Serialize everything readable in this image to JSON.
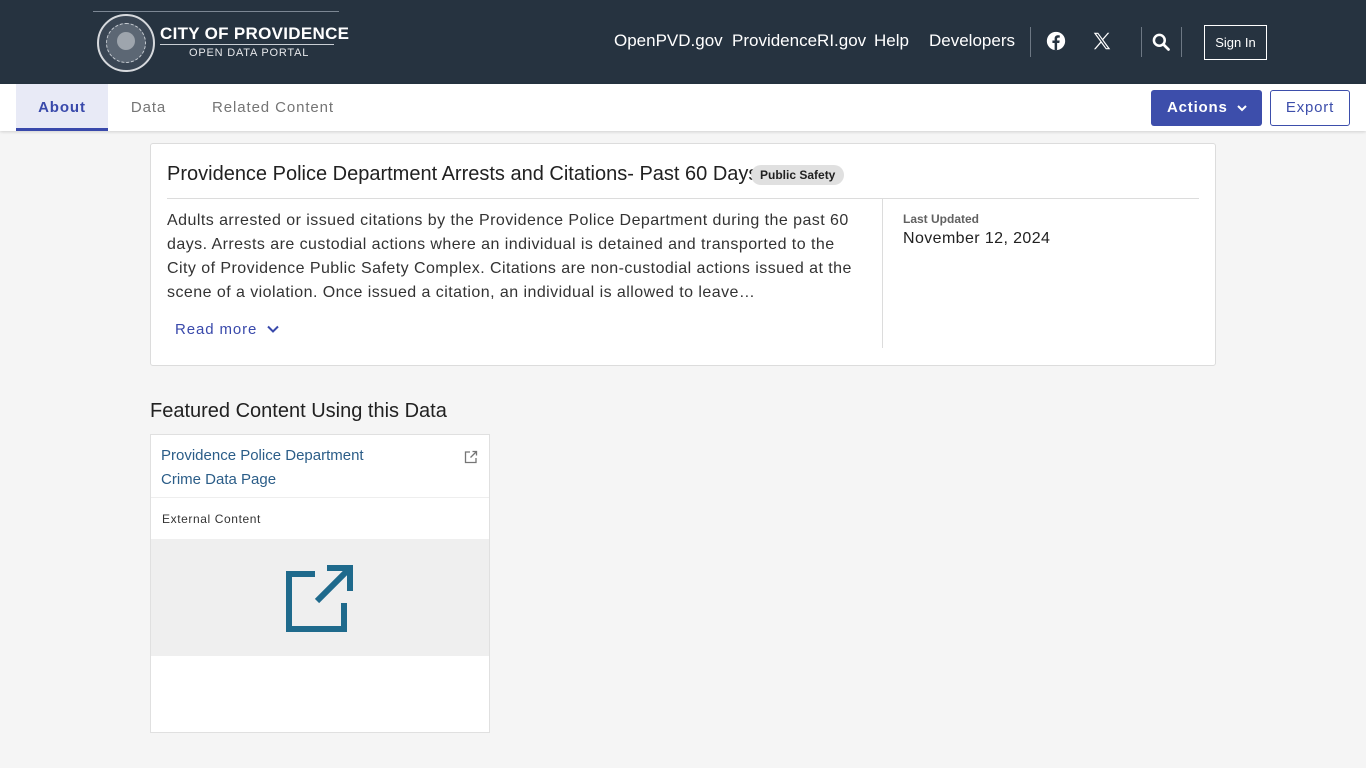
{
  "header": {
    "logo_title": "CITY OF PROVIDENCE",
    "logo_subtitle": "OPEN DATA PORTAL",
    "nav": [
      "OpenPVD.gov",
      "ProvidenceRI.gov",
      "Help",
      "Developers"
    ],
    "sign_in": "Sign In",
    "icons": [
      "facebook-icon",
      "x-twitter-icon",
      "search-icon"
    ]
  },
  "tabs": {
    "items": [
      "About",
      "Data",
      "Related Content"
    ],
    "active": "About",
    "actions_label": "Actions",
    "export_label": "Export"
  },
  "dataset": {
    "title": "Providence Police Department Arrests and Citations- Past 60 Days",
    "category": "Public Safety",
    "description": "Adults arrested or issued citations by the Providence Police Department during the past 60 days. Arrests are custodial actions where an individual is detained and transported to the City of Providence Public Safety Complex. Citations are non-custodial actions issued at the scene of a violation. Once issued a citation, an individual is allowed to leave…",
    "read_more": "Read more",
    "last_updated_label": "Last Updated",
    "last_updated_value": "November 12, 2024"
  },
  "featured": {
    "heading": "Featured Content Using this Data",
    "card": {
      "title": "Providence Police Department Crime Data Page",
      "type": "External Content"
    }
  },
  "colors": {
    "header_bg": "#263340",
    "accent": "#3d4eab",
    "link": "#2b5d88"
  }
}
